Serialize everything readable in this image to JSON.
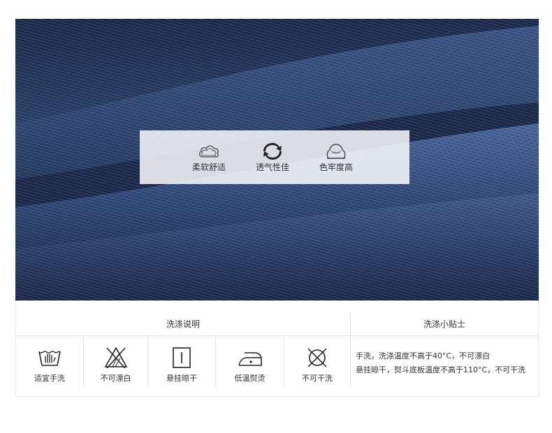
{
  "features": [
    {
      "icon": "cloud-icon",
      "label": "柔软舒适"
    },
    {
      "icon": "recycle-arrows-icon",
      "label": "透气性佳"
    },
    {
      "icon": "sweater-icon",
      "label": "色牢度高"
    }
  ],
  "care": {
    "left_title": "洗涤说明",
    "right_title": "洗涤小贴士",
    "symbols": [
      {
        "icon": "hand-wash-icon",
        "label": "适宜手洗"
      },
      {
        "icon": "no-bleach-icon",
        "label": "不可漂白"
      },
      {
        "icon": "hang-dry-icon",
        "label": "悬挂晾干"
      },
      {
        "icon": "low-iron-icon",
        "label": "低温熨烫"
      },
      {
        "icon": "no-dry-clean-icon",
        "label": "不可干洗"
      }
    ],
    "tips": [
      "手洗，洗涤温度不高于40°C，不可漂白",
      "悬挂晾干，熨斗底板温度不高于110°C，不可干洗"
    ]
  },
  "colors": {
    "denim_dark": "#16223f",
    "denim_light": "#3f5a8a",
    "overlay": "#ffffff",
    "text": "#333333",
    "divider": "#e6e6e6"
  }
}
